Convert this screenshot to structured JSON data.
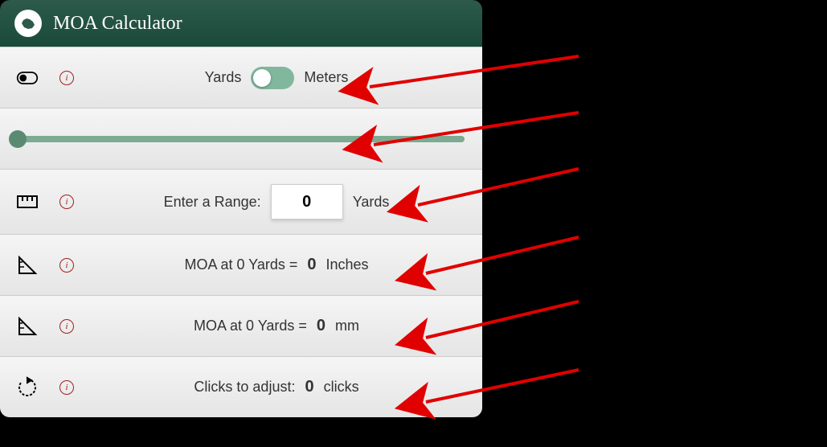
{
  "header": {
    "title": "MOA Calculator"
  },
  "unitRow": {
    "leftLabel": "Yards",
    "rightLabel": "Meters",
    "toggleOn": false
  },
  "rangeRow": {
    "label": "Enter a Range:",
    "value": "0",
    "unit": "Yards"
  },
  "moaInchesRow": {
    "label": "MOA at 0 Yards =",
    "value": "0",
    "unit": "Inches"
  },
  "moaMmRow": {
    "label": "MOA at 0 Yards =",
    "value": "0",
    "unit": "mm"
  },
  "clicksRow": {
    "label": "Clicks to adjust:",
    "value": "0",
    "unit": "clicks"
  }
}
